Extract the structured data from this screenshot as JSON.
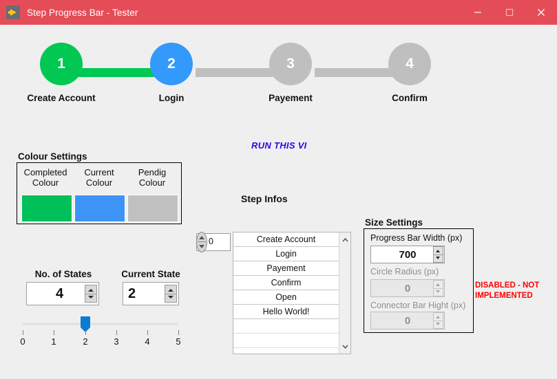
{
  "window": {
    "title": "Step Progress Bar - Tester",
    "icon": "labview-run-icon",
    "titlebar_color": "#e44d58",
    "minimize_label": "—",
    "maximize_label": "□",
    "close_label": "✕"
  },
  "progress_bar": {
    "steps": [
      {
        "number": "1",
        "label": "Create Account",
        "state": "completed",
        "color": "#00c853"
      },
      {
        "number": "2",
        "label": "Login",
        "state": "current",
        "color": "#3399fb"
      },
      {
        "number": "3",
        "label": "Payement",
        "state": "pending",
        "color": "#bfbfbf"
      },
      {
        "number": "4",
        "label": "Confirm",
        "state": "pending",
        "color": "#bfbfbf"
      }
    ],
    "connectors": [
      {
        "state": "completed",
        "color": "#00c853"
      },
      {
        "state": "pending",
        "color": "#bfbfbf"
      },
      {
        "state": "pending",
        "color": "#bfbfbf"
      }
    ]
  },
  "run_vi": {
    "label": "RUN THIS VI",
    "color": "#3300ee"
  },
  "colour_settings": {
    "title": "Colour Settings",
    "swatches": [
      {
        "label_line1": "Completed",
        "label_line2": "Colour",
        "color": "#00c05a"
      },
      {
        "label_line1": "Current",
        "label_line2": "Colour",
        "color": "#3d94f6"
      },
      {
        "label_line1": "Pendig",
        "label_line2": "Colour",
        "color": "#c0c0c0"
      }
    ]
  },
  "step_infos": {
    "title": "Step Infos",
    "index_value": "0",
    "items": [
      "Create Account",
      "Login",
      "Payement",
      "Confirm",
      "Open",
      "Hello World!",
      "",
      ""
    ],
    "scroll_up_icon": "chevron-up-icon",
    "scroll_down_icon": "chevron-down-icon"
  },
  "size_settings": {
    "title": "Size Settings",
    "fields": [
      {
        "label": "Progress Bar Width (px)",
        "value": "700",
        "disabled": false
      },
      {
        "label": "Circle Radius (px)",
        "value": "0",
        "disabled": true
      },
      {
        "label": "Connector Bar Hight (px)",
        "value": "0",
        "disabled": true
      }
    ],
    "disabled_note_line1": "DISABLED - NOT",
    "disabled_note_line2": "IMPLEMENTED",
    "disabled_note_color": "#ff0000"
  },
  "state_controls": {
    "num_states": {
      "label": "No. of States",
      "value": "4"
    },
    "current_state": {
      "label": "Current State",
      "value": "2"
    },
    "slider": {
      "value": 2,
      "min": 0,
      "max": 5,
      "ticks": [
        "0",
        "1",
        "2",
        "3",
        "4",
        "5"
      ]
    }
  }
}
